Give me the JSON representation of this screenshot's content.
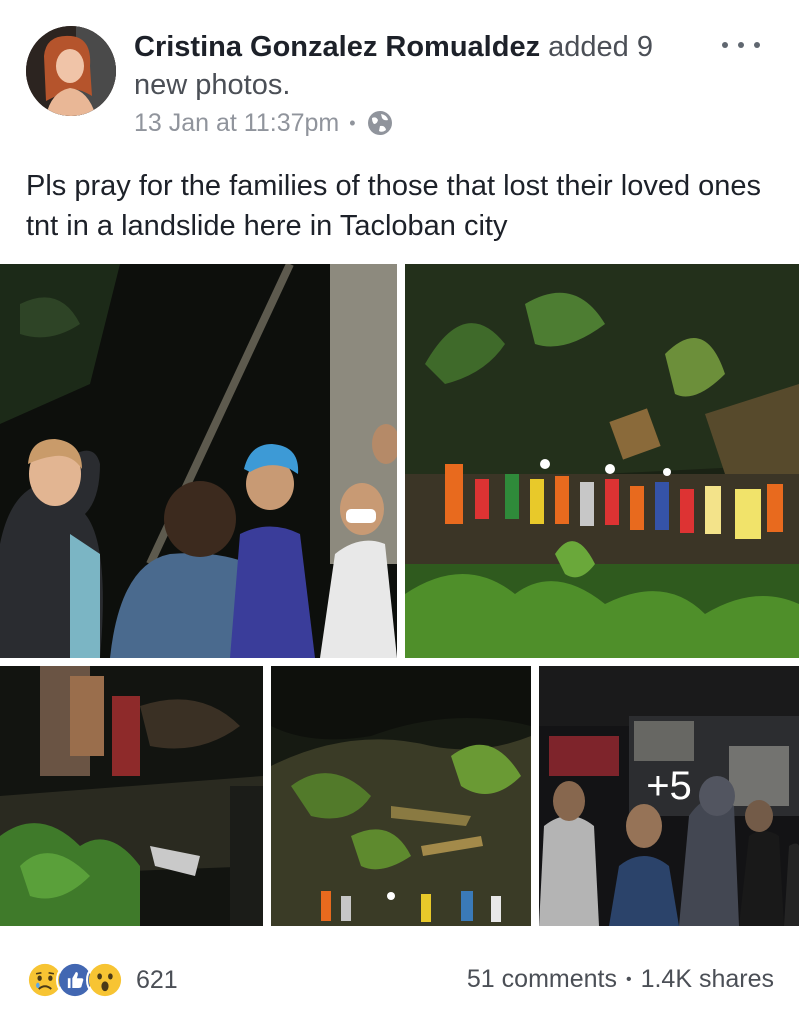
{
  "post": {
    "author": "Cristina Gonzalez Romualdez",
    "action": "added 9 new photos.",
    "timestamp": "13 Jan at 11:37pm",
    "separator": "•",
    "privacy_icon": "globe-icon",
    "text": "Pls pray for the families of those that lost their loved ones tnt in a landslide here in Tacloban city",
    "more_photos": "+5"
  },
  "photos": [
    {
      "name": "photo-night-meeting"
    },
    {
      "name": "photo-rescue-crowd"
    },
    {
      "name": "photo-night-path"
    },
    {
      "name": "photo-landslide-slope"
    },
    {
      "name": "photo-group-gathering"
    }
  ],
  "reactions": {
    "icons": [
      "sad-reaction-icon",
      "like-reaction-icon",
      "wow-reaction-icon"
    ],
    "count": "621"
  },
  "stats": {
    "comments": "51 comments",
    "shares": "1.4K shares"
  },
  "colors": {
    "like_blue": "#4267b2",
    "reaction_yellow": "#f7c433",
    "meta_gray": "#90949c"
  }
}
